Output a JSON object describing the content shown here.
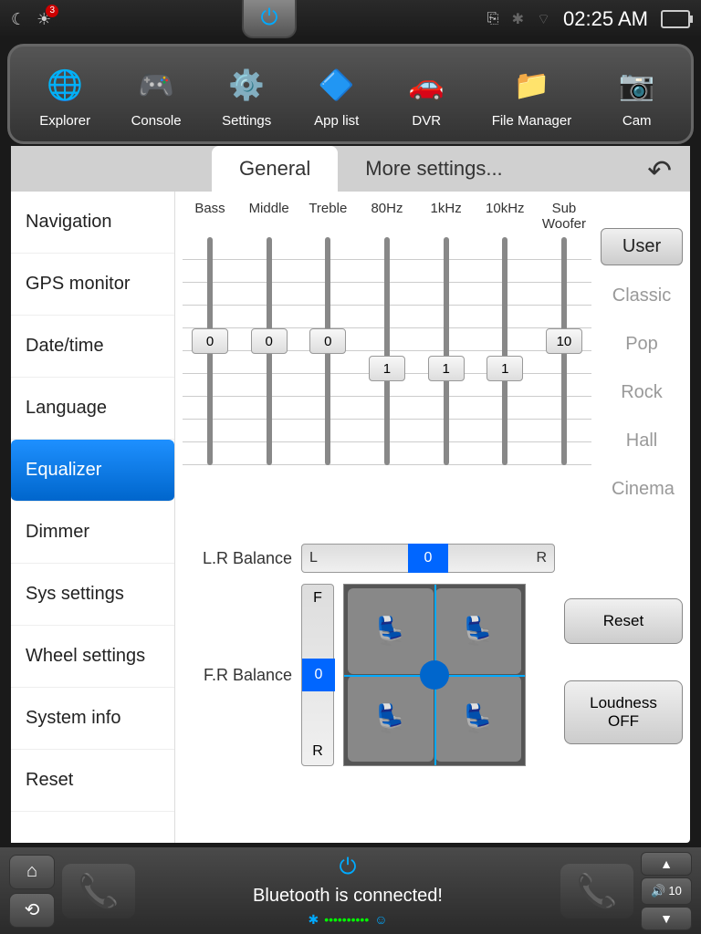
{
  "status": {
    "time": "02:25 AM",
    "badge": "3"
  },
  "apps": [
    {
      "label": "Explorer",
      "icon": "🌐"
    },
    {
      "label": "Console",
      "icon": "🎮"
    },
    {
      "label": "Settings",
      "icon": "⚙️"
    },
    {
      "label": "App list",
      "icon": "🔷"
    },
    {
      "label": "DVR",
      "icon": "🚗"
    },
    {
      "label": "File Manager",
      "icon": "📁"
    },
    {
      "label": "Cam",
      "icon": "📷"
    }
  ],
  "tabs": {
    "general": "General",
    "more": "More settings..."
  },
  "sidebar": [
    "Navigation",
    "GPS monitor",
    "Date/time",
    "Language",
    "Equalizer",
    "Dimmer",
    "Sys settings",
    "Wheel settings",
    "System info",
    "Reset"
  ],
  "sidebar_active": 4,
  "eq": {
    "bands": [
      {
        "label": "Bass",
        "value": "0",
        "pos": 40
      },
      {
        "label": "Middle",
        "value": "0",
        "pos": 40
      },
      {
        "label": "Treble",
        "value": "0",
        "pos": 40
      },
      {
        "label": "80Hz",
        "value": "1",
        "pos": 52
      },
      {
        "label": "1kHz",
        "value": "1",
        "pos": 52
      },
      {
        "label": "10kHz",
        "value": "1",
        "pos": 52
      },
      {
        "label": "Sub Woofer",
        "value": "10",
        "pos": 40
      }
    ],
    "presets": [
      "User",
      "Classic",
      "Pop",
      "Rock",
      "Hall",
      "Cinema"
    ],
    "preset_active": 0
  },
  "balance": {
    "lr_label": "L.R Balance",
    "lr_value": "0",
    "lr_left": "L",
    "lr_right": "R",
    "fr_label": "F.R Balance",
    "fr_value": "0",
    "fr_front": "F",
    "fr_rear": "R"
  },
  "actions": {
    "reset": "Reset",
    "loudness": "Loudness OFF"
  },
  "bottom": {
    "status": "Bluetooth is connected!",
    "volume": "10"
  }
}
